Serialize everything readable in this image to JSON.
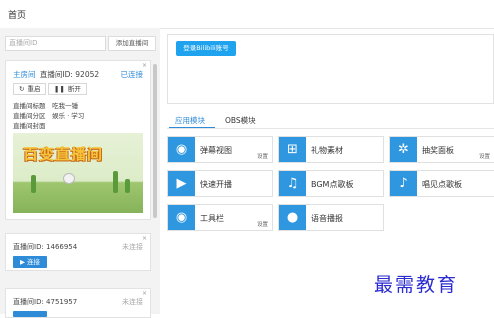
{
  "page": {
    "title": "首页"
  },
  "left": {
    "room_id_placeholder": "直播间ID",
    "add_room_label": "添加直播间",
    "main_room": {
      "tag": "主房间",
      "room_id_text": "直播间ID: 92052",
      "status": "已连接",
      "restart_label": "重启",
      "disconnect_label": "断开",
      "title_label": "直播间标题",
      "title_value": "吃我一锤",
      "zone_label": "直播间分区",
      "zone_value": "娱乐 · 学习",
      "cover_label": "直播间封面",
      "cover_text": "百变直播间"
    },
    "rooms": [
      {
        "room_id_text": "直播间ID: 1466954",
        "status": "未连接",
        "connect_label": "连接"
      },
      {
        "room_id_text": "直播间ID: 4751957",
        "status": "未连接",
        "connect_label": "连接"
      }
    ],
    "close_glyph": "×"
  },
  "login": {
    "button_label": "登录Bilibili账号"
  },
  "tabs": {
    "app": "应用模块",
    "obs": "OBS模块"
  },
  "tiles": [
    {
      "label": "弹幕视图",
      "icon": "chat-bubble-icon",
      "setting": "设置"
    },
    {
      "label": "礼物素材",
      "icon": "gift-icon",
      "setting": ""
    },
    {
      "label": "抽奖面板",
      "icon": "lottery-wheel-icon",
      "setting": "设置"
    },
    {
      "label": "快速开播",
      "icon": "play-icon",
      "setting": ""
    },
    {
      "label": "BGM点歌板",
      "icon": "music-note-icon",
      "setting": ""
    },
    {
      "label": "唱见点歌板",
      "icon": "microphone-stand-icon",
      "setting": ""
    },
    {
      "label": "工具栏",
      "icon": "toolbar-icon",
      "setting": "设置"
    },
    {
      "label": "语音播报",
      "icon": "microphone-icon",
      "setting": ""
    }
  ],
  "watermark": "最需教育",
  "colors": {
    "accent": "#2e8bd8",
    "tile_icon_bg": "#2f97e0",
    "login_btn": "#1fa3ef"
  }
}
